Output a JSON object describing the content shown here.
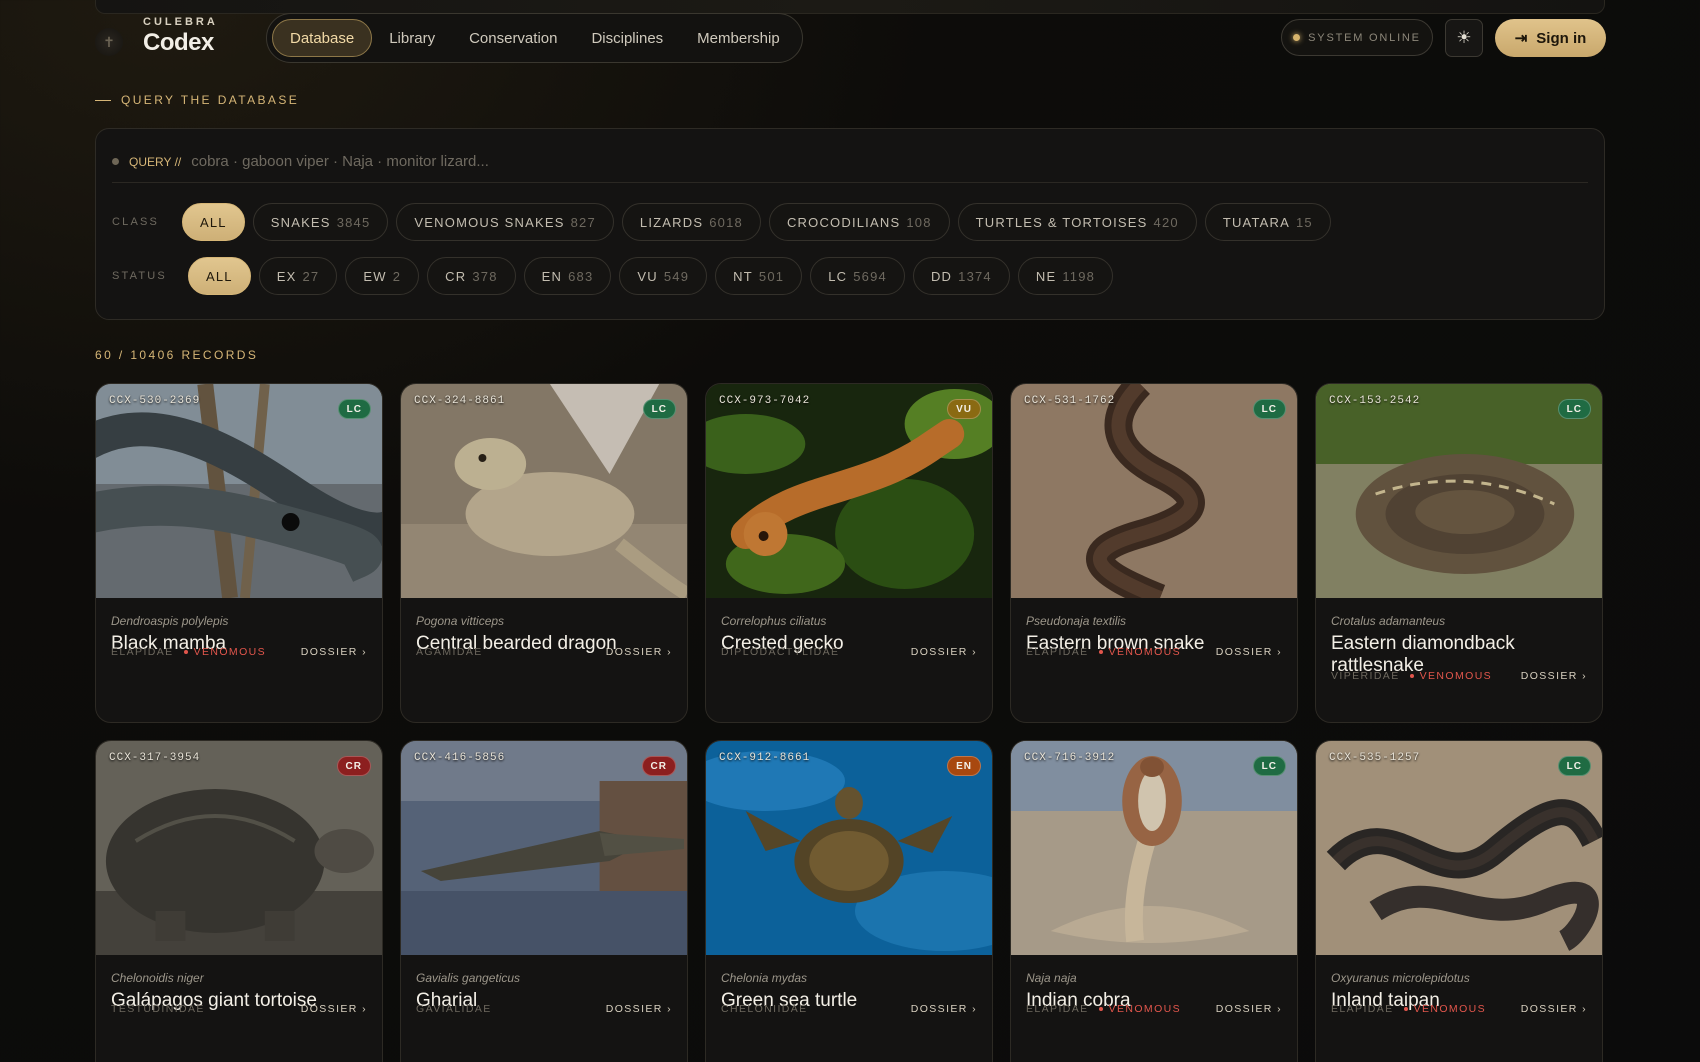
{
  "brand": {
    "sub": "CULEBRA",
    "name": "Codex",
    "mark": "✝"
  },
  "nav": [
    "Database",
    "Library",
    "Conservation",
    "Disciplines",
    "Membership"
  ],
  "status": "SYSTEM ONLINE",
  "theme_icon": "☀",
  "signin": {
    "icon": "⇥",
    "label": "Sign in"
  },
  "section_label": "QUERY THE DATABASE",
  "query": {
    "prefix": "QUERY //",
    "placeholder": "cobra · gaboon viper · Naja · monitor lizard..."
  },
  "class_filter": {
    "label": "CLASS",
    "chips": [
      {
        "label": "ALL",
        "count": ""
      },
      {
        "label": "SNAKES",
        "count": "3845"
      },
      {
        "label": "VENOMOUS SNAKES",
        "count": "827"
      },
      {
        "label": "LIZARDS",
        "count": "6018"
      },
      {
        "label": "CROCODILIANS",
        "count": "108"
      },
      {
        "label": "TURTLES & TORTOISES",
        "count": "420"
      },
      {
        "label": "TUATARA",
        "count": "15"
      }
    ]
  },
  "status_filter": {
    "label": "STATUS",
    "chips": [
      {
        "label": "ALL",
        "count": ""
      },
      {
        "label": "EX",
        "count": "27"
      },
      {
        "label": "EW",
        "count": "2"
      },
      {
        "label": "CR",
        "count": "378"
      },
      {
        "label": "EN",
        "count": "683"
      },
      {
        "label": "VU",
        "count": "549"
      },
      {
        "label": "NT",
        "count": "501"
      },
      {
        "label": "LC",
        "count": "5694"
      },
      {
        "label": "DD",
        "count": "1374"
      },
      {
        "label": "NE",
        "count": "1198"
      }
    ]
  },
  "records": "60 / 10406 RECORDS",
  "dossier_label": "DOSSIER ›",
  "venomous_label": "VENOMOUS",
  "badge_colors": {
    "LC": "#1f6b43",
    "VU": "#8a6a12",
    "CR": "#8c1f1f",
    "EN": "#a8480f"
  },
  "cards": [
    {
      "id": "CCX-530-2369",
      "status": "LC",
      "sci": "Dendroaspis polylepis",
      "name": "Black mamba",
      "family": "ELAPIDAE",
      "venomous": "VENOMOUS",
      "art": "snake-gray"
    },
    {
      "id": "CCX-324-8861",
      "status": "LC",
      "sci": "Pogona vitticeps",
      "name": "Central bearded dragon",
      "family": "AGAMIDAE",
      "venomous": "",
      "art": "lizard-sand"
    },
    {
      "id": "CCX-973-7042",
      "status": "VU",
      "sci": "Correlophus ciliatus",
      "name": "Crested gecko",
      "family": "DIPLODACTYLIDAE",
      "venomous": "",
      "art": "gecko-leaf"
    },
    {
      "id": "CCX-531-1762",
      "status": "LC",
      "sci": "Pseudonaja textilis",
      "name": "Eastern brown snake",
      "family": "ELAPIDAE",
      "venomous": "VENOMOUS",
      "art": "snake-brown"
    },
    {
      "id": "CCX-153-2542",
      "status": "LC",
      "sci": "Crotalus adamanteus",
      "name": "Eastern diamondback rattlesnake",
      "family": "VIPERIDAE",
      "venomous": "VENOMOUS",
      "art": "rattler"
    },
    {
      "id": "CCX-317-3954",
      "status": "CR",
      "sci": "Chelonoidis niger",
      "name": "Galápagos giant tortoise",
      "family": "TESTUDINIDAE",
      "venomous": "",
      "art": "tortoise"
    },
    {
      "id": "CCX-416-5856",
      "status": "CR",
      "sci": "Gavialis gangeticus",
      "name": "Gharial",
      "family": "GAVIALIDAE",
      "venomous": "",
      "art": "gharial"
    },
    {
      "id": "CCX-912-8661",
      "status": "EN",
      "sci": "Chelonia mydas",
      "name": "Green sea turtle",
      "family": "CHELONIIDAE",
      "venomous": "",
      "art": "seaturtle"
    },
    {
      "id": "CCX-716-3912",
      "status": "LC",
      "sci": "Naja naja",
      "name": "Indian cobra",
      "family": "ELAPIDAE",
      "venomous": "VENOMOUS",
      "art": "cobra"
    },
    {
      "id": "CCX-535-1257",
      "status": "LC",
      "sci": "Oxyuranus microlepidotus",
      "name": "Inland taipan",
      "family": "ELAPIDAE",
      "venomous": "VENOMOUS",
      "art": "taipan"
    }
  ]
}
